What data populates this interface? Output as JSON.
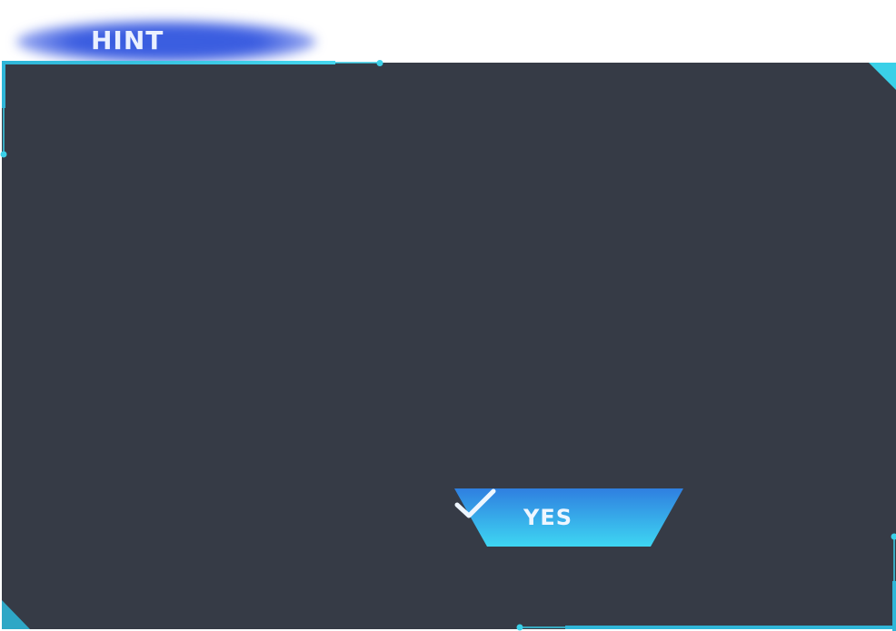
{
  "dialog": {
    "title": "HINT",
    "message": "",
    "confirm_label": "YES",
    "confirm_icon": "checkmark-icon"
  },
  "colors": {
    "panel_background": "#363b46",
    "accent_cyan": "#3ad0e8",
    "title_glow": "#3a5ce0",
    "button_top": "#2f7fe0",
    "button_bottom": "#3ed6f2"
  }
}
